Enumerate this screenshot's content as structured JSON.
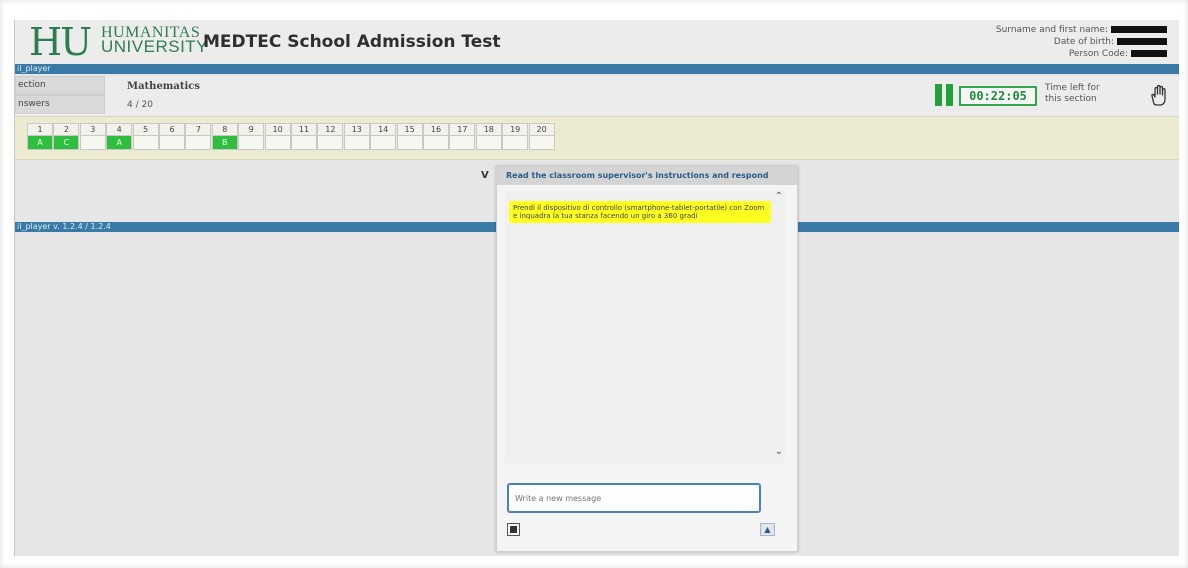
{
  "header": {
    "logo_mark": "HU",
    "logo_line1": "HUMANITAS",
    "logo_line2": "UNIVERSITY",
    "title": "MEDTEC School Admission Test",
    "candidate": {
      "surname_label": "Surname and first name:",
      "dob_label": "Date of birth:",
      "code_label": "Person Code:"
    }
  },
  "top_bar_label": "il_player",
  "section": {
    "label": "ection",
    "value": "Mathematics",
    "answers_label": "nswers",
    "answers_value": "4 / 20"
  },
  "timer": {
    "value": "00:22:05",
    "label": "Time left for this section",
    "accent": "#2fa84a"
  },
  "questions": [
    {
      "num": "1",
      "ans": "A"
    },
    {
      "num": "2",
      "ans": "C"
    },
    {
      "num": "3",
      "ans": ""
    },
    {
      "num": "4",
      "ans": "A"
    },
    {
      "num": "5",
      "ans": ""
    },
    {
      "num": "6",
      "ans": ""
    },
    {
      "num": "7",
      "ans": ""
    },
    {
      "num": "8",
      "ans": "B"
    },
    {
      "num": "9",
      "ans": ""
    },
    {
      "num": "10",
      "ans": ""
    },
    {
      "num": "11",
      "ans": ""
    },
    {
      "num": "12",
      "ans": ""
    },
    {
      "num": "13",
      "ans": ""
    },
    {
      "num": "14",
      "ans": ""
    },
    {
      "num": "15",
      "ans": ""
    },
    {
      "num": "16",
      "ans": ""
    },
    {
      "num": "17",
      "ans": ""
    },
    {
      "num": "18",
      "ans": ""
    },
    {
      "num": "19",
      "ans": ""
    },
    {
      "num": "20",
      "ans": ""
    }
  ],
  "partial_v": "V",
  "version_bar": "il_player v. 1.2.4 / 1.2.4",
  "chat": {
    "title": "Read the classroom supervisor's instructions and respond",
    "message": "Prendi il dispositivo di controllo (smartphone-tablet-portatile) con Zoom e inquadra la tua stanza facendo un giro a 360 gradi",
    "input_placeholder": "Write a new message",
    "send_icon": "send-icon",
    "attach_icon": "attach-icon"
  },
  "colors": {
    "brand_green": "#2e7d4f",
    "bar_blue": "#3a7aa6",
    "answered_green": "#2fbf3f",
    "message_yellow": "#ffff22"
  }
}
